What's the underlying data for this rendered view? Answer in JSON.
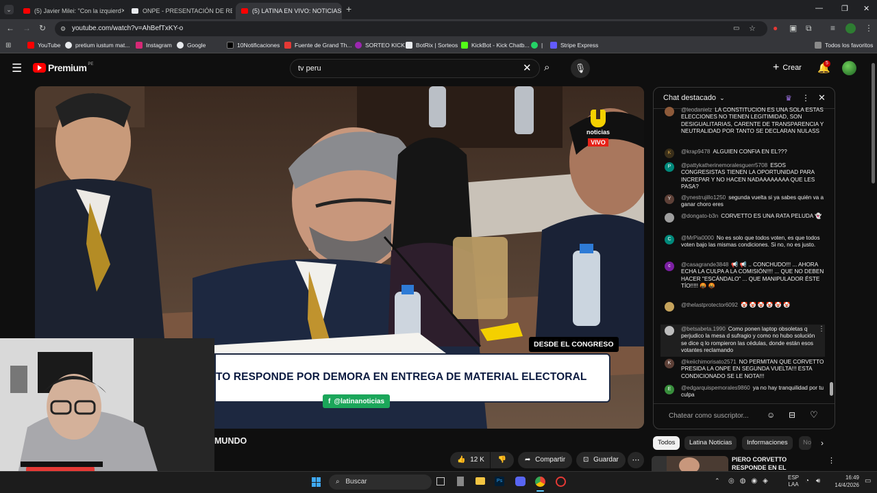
{
  "browser": {
    "tabs": [
      {
        "title": "(5) Javier Milei: \"Con la izquierd"
      },
      {
        "title": "ONPE - PRESENTACIÓN DE RE"
      },
      {
        "title": "(5) LATINA EN VIVO: NOTICIAS"
      }
    ],
    "new_tab": "+",
    "url": "youtube.com/watch?v=AhBefTxKY-o",
    "bookmarks": [
      "YouTube",
      "pretium iustum mat...",
      "Instagram",
      "Google",
      "10Notificaciones",
      "Fuente de Grand Th...",
      "SORTEO KICK",
      "BotRix | Sorteos",
      "KickBot - Kick Chatb...",
      "|",
      "Stripe Express"
    ],
    "all_favorites": "Todos los favoritos"
  },
  "youtube": {
    "logo": "Premium",
    "logo_region": "PE",
    "search_value": "tv peru",
    "create_label": "Crear",
    "notif_count": "5"
  },
  "video": {
    "channel_bug": "noticias",
    "live_badge": "VIVO",
    "location_badge": "DESDE EL CONGRESO",
    "headline": "TO RESPONDE POR DEMORA EN ENTREGA DE MATERIAL ELECTORAL",
    "handle": "@latinanoticias",
    "title_fragment": "MUNDO",
    "likes": "12 K",
    "share": "Compartir",
    "save": "Guardar"
  },
  "chat": {
    "title": "Chat destacado",
    "input_placeholder": "Chatear como suscriptor...",
    "messages": [
      {
        "user": "@leodanielz",
        "text": "LA CONSTITUCION ES UNA SOLA ESTAS ELECCIONES NO TIENEN LEGITIMIDAD, SON DESIGUALITARIAS, CARENTE DE TRANSPARENCIA Y NEUTRALIDAD POR TANTO SE DECLARAN NULASS",
        "initial": ""
      },
      {
        "user": "@krap9478",
        "text": "ALGUIEN CONFIA EN EL???",
        "initial": "K"
      },
      {
        "user": "@pattykatherinemoralesguerr5708",
        "text": "ESOS CONGRESISTAS TIENEN LA OPORTUNIDAD PARA INCREPAR Y NO HACEN NADAAAAAAAA QUE LES PASA?",
        "initial": "P"
      },
      {
        "user": "@ynestrujillo1250",
        "text": "segunda vuelta si ya sabes quién va a ganar choro eres",
        "initial": "Y"
      },
      {
        "user": "@dongato-b3n",
        "text": "CORVETTO ES UNA RATA PELUDA 👻",
        "initial": ""
      },
      {
        "user": "@MrPia0000",
        "text": "No es solo que todos voten, es que todos voten bajo las mismas condiciones. Si no, no es justo.",
        "initial": "C"
      },
      {
        "user": "@casagrande3848",
        "text": "📢 📢 .. CONCHUDO!!! ... AHORA ECHA LA CULPA A LA COMISIÓN!!!! ... QUE NO DEBEN HACER \"ESCÁNDALO\" ... QUE MANIPULADOR ÉSTE TÍO!!!!! 🤬 🤬",
        "initial": "c"
      },
      {
        "user": "@thelastprotector6092",
        "text": "🤡 🤡 🤡 🤡 🤡 🤡",
        "initial": ""
      },
      {
        "user": "@betsabeta.1990",
        "text": "Como ponen laptop obsoletas q perjudico la mesa d sufragio y como no hubo solución se dice q lo rompieron las cédulas, donde están esos votantes reclamando",
        "initial": ""
      },
      {
        "user": "@keiichimorisato2571",
        "text": "NO PERMITAN QUE CORVETTO PRESIDA LA ONPE EN SEGUNDA VUELTA!!! ESTA CONDICIONADO SE LE NOTA!!!",
        "initial": "K"
      },
      {
        "user": "@edgarquispemorales9860",
        "text": "ya no hay tranquilidad por tu culpa",
        "initial": "E"
      }
    ]
  },
  "filters": [
    "Todos",
    "Latina Noticias",
    "Informaciones",
    "No"
  ],
  "related": {
    "title": "PIERO CORVETTO RESPONDE EN EL CONGRESO DEL PERÚ: ..."
  },
  "taskbar": {
    "search": "Buscar",
    "lang": "ESP",
    "lang2": "LAA",
    "time": "16:49",
    "date": "14/4/2026"
  },
  "colors": {
    "accent": "#ff0000",
    "live_red": "#e62117",
    "brand_yellow": "#f4d000",
    "green_handle": "#1ba65a"
  }
}
